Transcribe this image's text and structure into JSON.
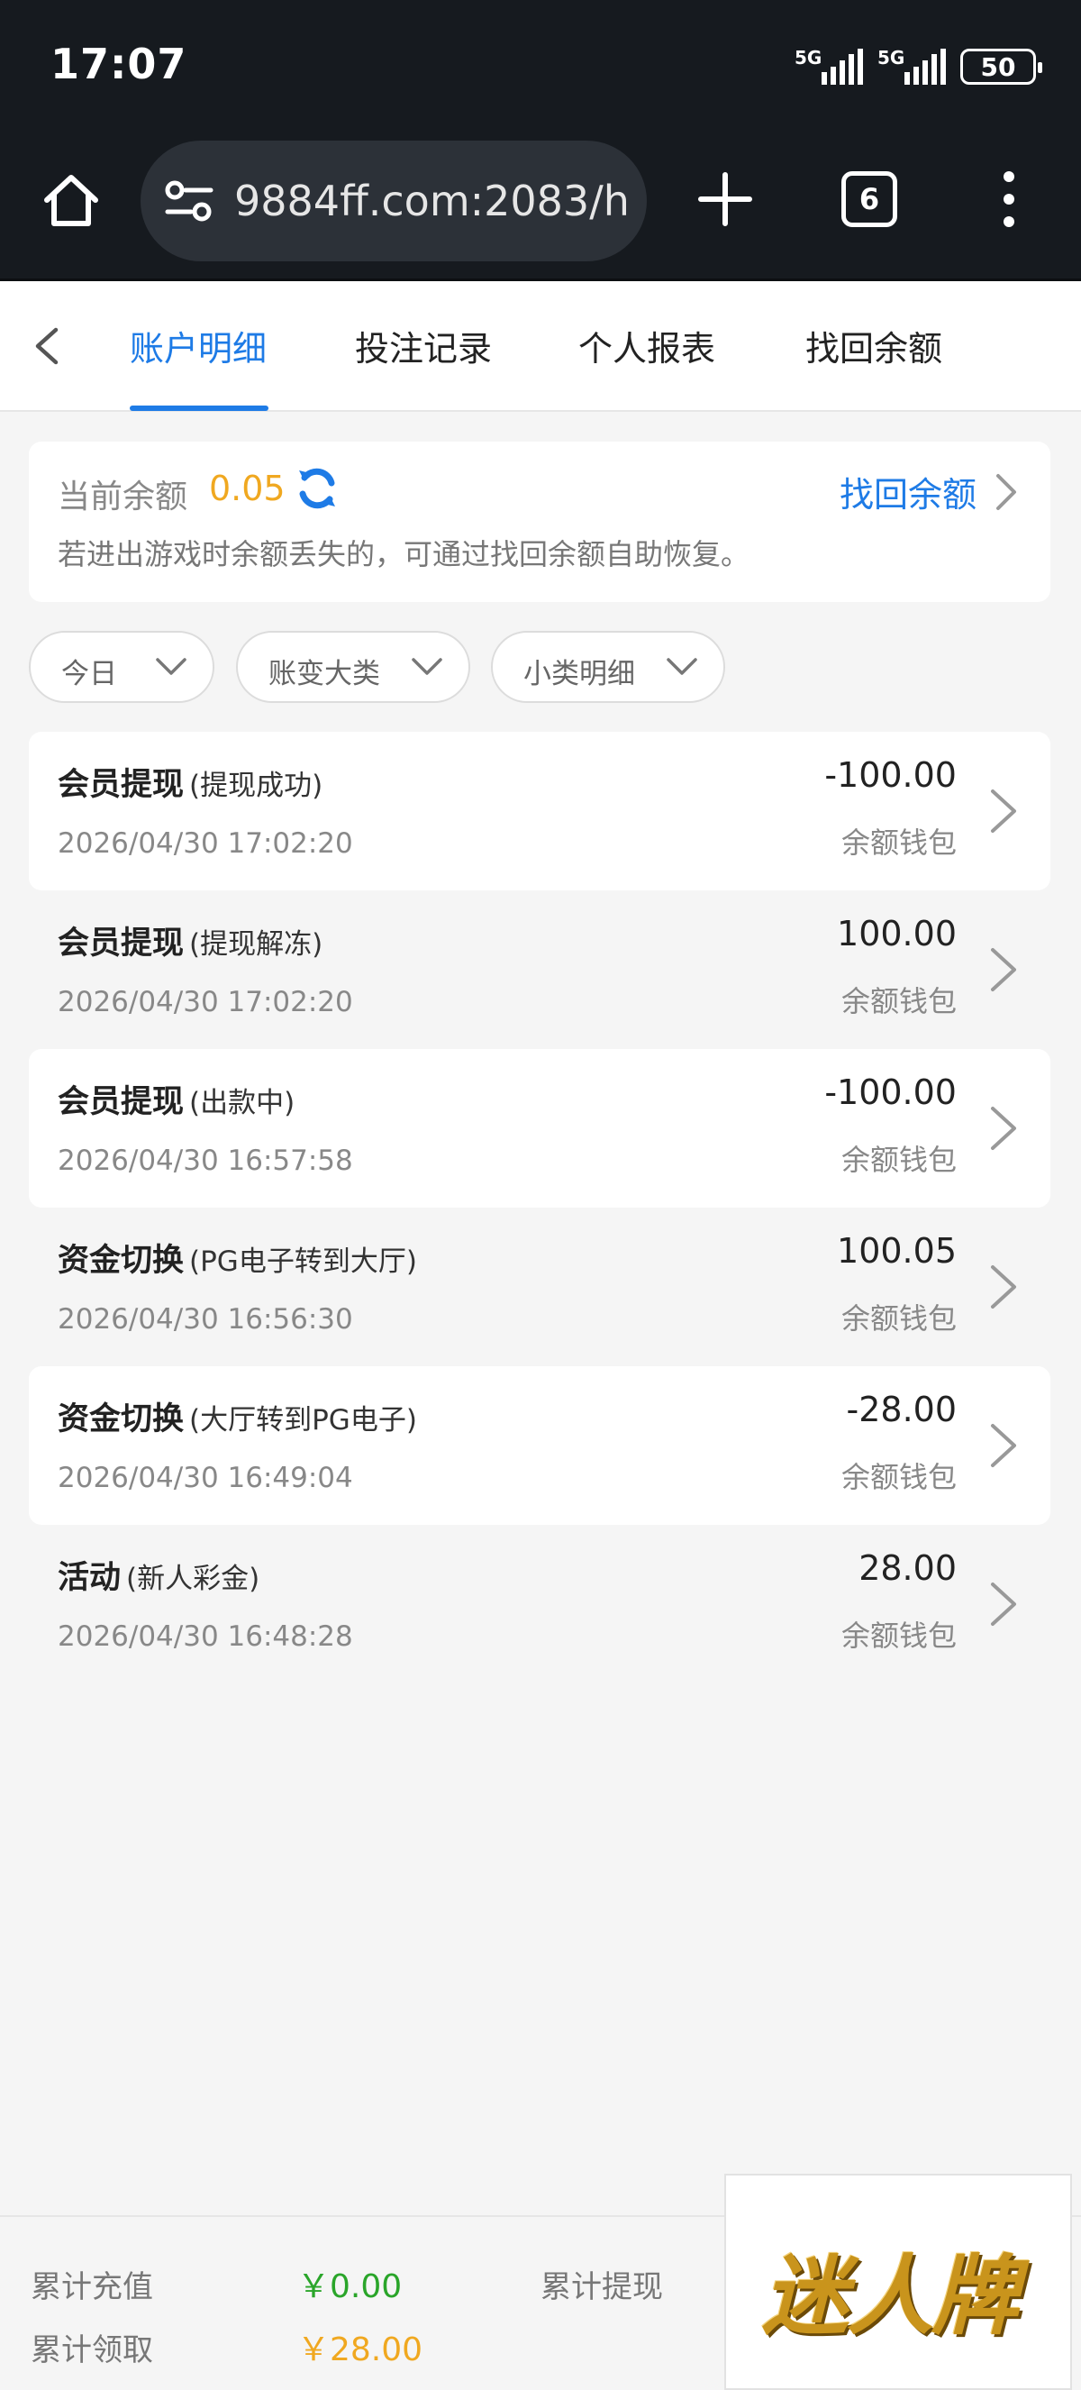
{
  "status_bar": {
    "time": "17:07",
    "signal1": "5G",
    "signal2": "5G",
    "battery": "50"
  },
  "browser": {
    "url": "9884ff.com:2083/h",
    "tab_count": "6"
  },
  "tabs": [
    {
      "label": "账户明细",
      "active": true
    },
    {
      "label": "投注记录",
      "active": false
    },
    {
      "label": "个人报表",
      "active": false
    },
    {
      "label": "找回余额",
      "active": false
    }
  ],
  "balance": {
    "label": "当前余额",
    "value": "0.05",
    "recover_link": "找回余额",
    "hint": "若进出游戏时余额丢失的，可通过找回余额自助恢复。"
  },
  "filters": [
    {
      "label": "今日"
    },
    {
      "label": "账变大类"
    },
    {
      "label": "小类明细"
    }
  ],
  "transactions": [
    {
      "title": "会员提现",
      "sub": "(提现成功)",
      "time": "2026/04/30 17:02:20",
      "amount": "-100.00",
      "wallet": "余额钱包"
    },
    {
      "title": "会员提现",
      "sub": "(提现解冻)",
      "time": "2026/04/30 17:02:20",
      "amount": "100.00",
      "wallet": "余额钱包"
    },
    {
      "title": "会员提现",
      "sub": "(出款中)",
      "time": "2026/04/30 16:57:58",
      "amount": "-100.00",
      "wallet": "余额钱包"
    },
    {
      "title": "资金切换",
      "sub": "(PG电子转到大厅)",
      "time": "2026/04/30 16:56:30",
      "amount": "100.05",
      "wallet": "余额钱包"
    },
    {
      "title": "资金切换",
      "sub": "(大厅转到PG电子)",
      "time": "2026/04/30 16:49:04",
      "amount": "-28.00",
      "wallet": "余额钱包"
    },
    {
      "title": "活动",
      "sub": "(新人彩金)",
      "time": "2026/04/30 16:48:28",
      "amount": "28.00",
      "wallet": "余额钱包"
    }
  ],
  "footer": {
    "total_recharge_label": "累计充值",
    "total_recharge_value": "￥0.00",
    "total_withdraw_label": "累计提现",
    "total_claim_label": "累计领取",
    "total_claim_value": "￥28.00",
    "ad_text": "迷人牌"
  },
  "colors": {
    "accent": "#1e7be6",
    "balance": "#f0a820",
    "recharge": "#2aa52a",
    "claim": "#f0a820"
  }
}
